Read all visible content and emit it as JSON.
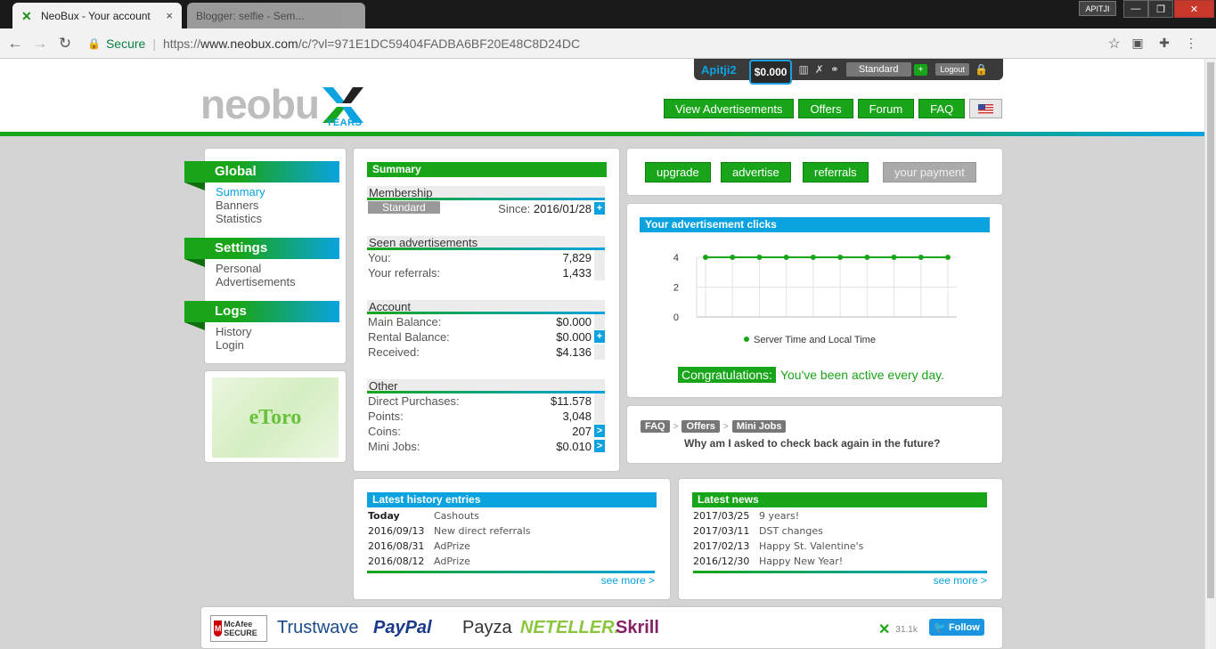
{
  "browser": {
    "tabs": [
      {
        "title": "NeoBux - Your account"
      },
      {
        "title": "Blogger: selfie - Sem..."
      }
    ],
    "user_chip": "APITJI",
    "secure_label": "Secure",
    "url_scheme": "https://",
    "url_host": "www.neobux.com",
    "url_path": "/c/?vl=971E1DC59404FADBA6BF20E48C8D24DC"
  },
  "topbar": {
    "username": "Apitji2",
    "balance": "$0.000",
    "membership": "Standard",
    "plus": "+",
    "logout": "Logout"
  },
  "logo": {
    "text": "neobu",
    "years": "YEARS"
  },
  "mainnav": [
    "View Advertisements",
    "Offers",
    "Forum",
    "FAQ"
  ],
  "sidebar": {
    "global": {
      "title": "Global",
      "items": [
        "Summary",
        "Banners",
        "Statistics"
      ]
    },
    "settings": {
      "title": "Settings",
      "items": [
        "Personal",
        "Advertisements"
      ]
    },
    "logs": {
      "title": "Logs",
      "items": [
        "History",
        "Login"
      ]
    }
  },
  "etoro": "eToro",
  "summary": {
    "title": "Summary",
    "membership": {
      "head": "Membership",
      "type": "Standard",
      "since_label": "Since:",
      "since": "2016/01/28"
    },
    "seen": {
      "head": "Seen advertisements",
      "rows": [
        {
          "label": "You:",
          "value": "7,829"
        },
        {
          "label": "Your referrals:",
          "value": "1,433"
        }
      ]
    },
    "account": {
      "head": "Account",
      "rows": [
        {
          "label": "Main Balance:",
          "value": "$0.000"
        },
        {
          "label": "Rental Balance:",
          "value": "$0.000"
        },
        {
          "label": "Received:",
          "value": "$4.136"
        }
      ]
    },
    "other": {
      "head": "Other",
      "rows": [
        {
          "label": "Direct Purchases:",
          "value": "$11.578"
        },
        {
          "label": "Points:",
          "value": "3,048"
        },
        {
          "label": "Coins:",
          "value": "207"
        },
        {
          "label": "Mini Jobs:",
          "value": "$0.010"
        }
      ]
    }
  },
  "actions": [
    "upgrade",
    "advertise",
    "referrals",
    "your payment"
  ],
  "clicks": {
    "title": "Your advertisement clicks",
    "congrats_label": "Congratulations:",
    "congrats_msg": "You've been active every day."
  },
  "chart_data": {
    "type": "line",
    "title": "",
    "x": [
      1,
      2,
      3,
      4,
      5,
      6,
      7,
      8,
      9,
      10
    ],
    "series": [
      {
        "name": "Server Time and Local Time",
        "values": [
          4,
          4,
          4,
          4,
          4,
          4,
          4,
          4,
          4,
          4
        ]
      }
    ],
    "yticks": [
      0,
      2,
      4
    ],
    "ylim": [
      0,
      4
    ],
    "grid": true,
    "legend": "bottom",
    "color": "#19a519"
  },
  "faq": {
    "crumbs": [
      "FAQ",
      "Offers",
      "Mini Jobs"
    ],
    "question": "Why am I asked to check back again in the future?"
  },
  "history": {
    "title": "Latest history entries",
    "items": [
      {
        "date": "Today",
        "text": "Cashouts"
      },
      {
        "date": "2016/09/13",
        "text": "New direct referrals"
      },
      {
        "date": "2016/08/31",
        "text": "AdPrize"
      },
      {
        "date": "2016/08/12",
        "text": "AdPrize"
      }
    ],
    "see_more": "see more >"
  },
  "news": {
    "title": "Latest news",
    "items": [
      {
        "date": "2017/03/25",
        "text": "9 years!"
      },
      {
        "date": "2017/03/11",
        "text": "DST changes"
      },
      {
        "date": "2017/02/13",
        "text": "Happy St. Valentine's"
      },
      {
        "date": "2016/12/30",
        "text": "Happy New Year!"
      }
    ],
    "see_more": "see more >"
  },
  "footer": {
    "mcafee": "McAfee SECURE",
    "trustwave": "Trustwave",
    "paypal": "PayPal",
    "payza": "Payza",
    "neteller": "NETELLER.",
    "skrill": "Skrill",
    "count": "31.1k",
    "twitter": "Follow"
  }
}
